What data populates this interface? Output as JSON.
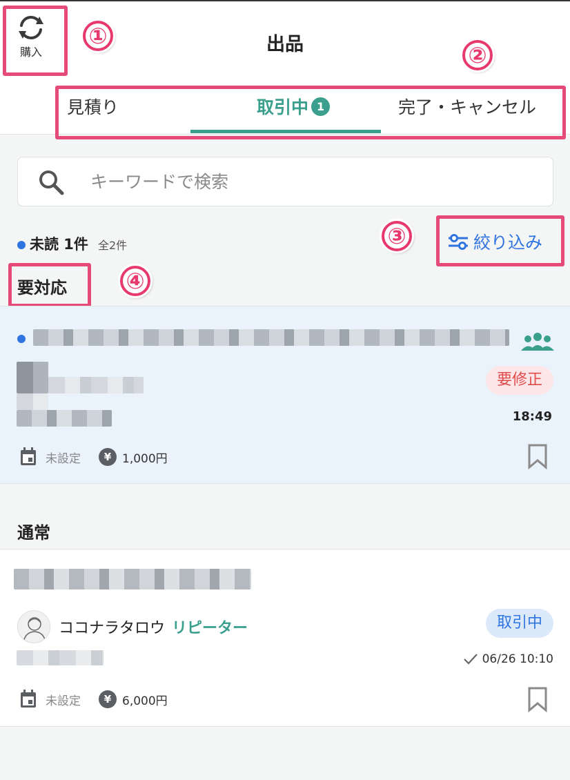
{
  "header": {
    "title": "出品",
    "swap_label": "購入"
  },
  "tabs": [
    {
      "label": "見積り",
      "active": false
    },
    {
      "label": "取引中",
      "active": true,
      "badge": "1"
    },
    {
      "label": "完了・キャンセル",
      "active": false
    }
  ],
  "search": {
    "placeholder": "キーワードで検索"
  },
  "summary": {
    "unread_label": "未読 1件",
    "total_label": "全2件"
  },
  "filter": {
    "label": "絞り込み"
  },
  "sections": {
    "urgent_title": "要対応",
    "normal_title": "通常"
  },
  "urgent_card": {
    "status": "要修正",
    "time": "18:49",
    "date_label": "未設定",
    "price": "1,000円"
  },
  "normal_card": {
    "user_name": "ココナラタロウ",
    "user_badge": "リピーター",
    "status": "取引中",
    "datetime": "06/26 10:10",
    "date_label": "未設定",
    "price": "6,000円"
  },
  "annotations": [
    "①",
    "②",
    "③",
    "④"
  ],
  "colors": {
    "accent": "#3a9f8d",
    "link": "#2f74e0",
    "annotation": "#e54a78",
    "alert": "#e04b4b"
  }
}
